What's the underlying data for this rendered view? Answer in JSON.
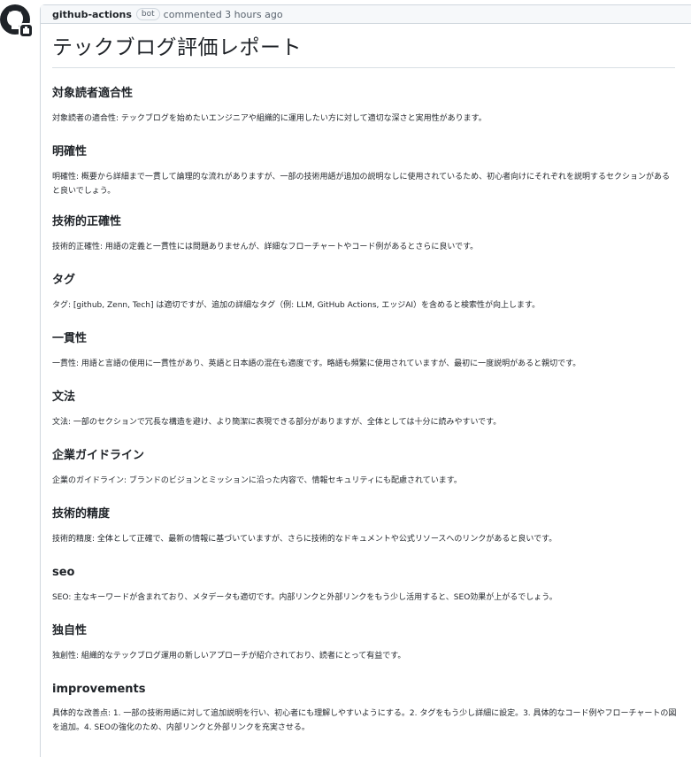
{
  "comment": {
    "author": "github-actions",
    "badge": "bot",
    "meta": "commented 3 hours ago"
  },
  "report": {
    "title": "テックブログ評価レポート",
    "sections": [
      {
        "heading": "対象読者適合性",
        "body": "対象読者の適合性: テックブログを始めたいエンジニアや組織的に運用したい方に対して適切な深さと実用性があります。"
      },
      {
        "heading": "明確性",
        "body": "明確性: 概要から詳細まで一貫して論理的な流れがありますが、一部の技術用語が追加の説明なしに使用されているため、初心者向けにそれぞれを説明するセクションがあると良いでしょう。"
      },
      {
        "heading": "技術的正確性",
        "body": "技術的正確性: 用語の定義と一貫性には問題ありませんが、詳細なフローチャートやコード例があるとさらに良いです。"
      },
      {
        "heading": "タグ",
        "body": "タグ: [github, Zenn, Tech] は適切ですが、追加の詳細なタグ（例: LLM, GitHub Actions, エッジAI）を含めると検索性が向上します。"
      },
      {
        "heading": "一貫性",
        "body": "一貫性: 用語と言語の使用に一貫性があり、英語と日本語の混在も適度です。略語も頻繁に使用されていますが、最初に一度説明があると親切です。"
      },
      {
        "heading": "文法",
        "body": "文法: 一部のセクションで冗長な構造を避け、より簡潔に表現できる部分がありますが、全体としては十分に読みやすいです。"
      },
      {
        "heading": "企業ガイドライン",
        "body": "企業のガイドライン: ブランドのビジョンとミッションに沿った内容で、情報セキュリティにも配慮されています。"
      },
      {
        "heading": "技術的精度",
        "body": "技術的精度: 全体として正確で、最新の情報に基づいていますが、さらに技術的なドキュメントや公式リソースへのリンクがあると良いです。"
      },
      {
        "heading": "seo",
        "body": "SEO: 主なキーワードが含まれており、メタデータも適切です。内部リンクと外部リンクをもう少し活用すると、SEO効果が上がるでしょう。"
      },
      {
        "heading": "独自性",
        "body": "独創性: 組織的なテックブログ運用の新しいアプローチが紹介されており、読者にとって有益です。"
      },
      {
        "heading": "improvements",
        "body": "具体的な改善点: 1. 一部の技術用語に対して追加説明を行い、初心者にも理解しやすいようにする。2. タグをもう少し詳細に設定。3. 具体的なコード例やフローチャートの図を追加。4. SEOの強化のため、内部リンクと外部リンクを充実させる。"
      }
    ]
  },
  "icons": {
    "avatar": "github-mark-icon",
    "avatar_badge": "bot-badge-icon"
  }
}
